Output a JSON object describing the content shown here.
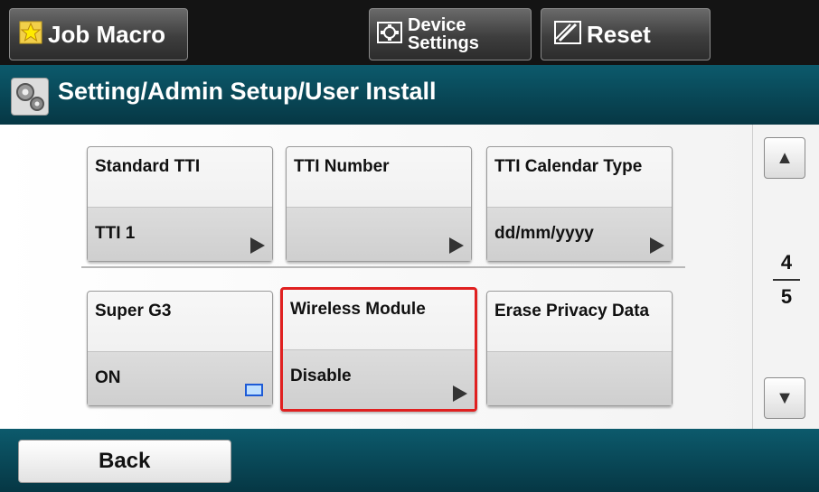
{
  "topbar": {
    "job_macro": "Job Macro",
    "device_settings_line1": "Device",
    "device_settings_line2": "Settings",
    "reset": "Reset"
  },
  "title": "Setting/Admin Setup/User Install",
  "tiles": [
    {
      "label": "Standard TTI",
      "value": "TTI 1",
      "indicator": "arrow"
    },
    {
      "label": "TTI Number",
      "value": "",
      "indicator": "arrow"
    },
    {
      "label": "TTI Calendar Type",
      "value": "dd/mm/yyyy",
      "indicator": "arrow"
    },
    {
      "label": "Super G3",
      "value": "ON",
      "indicator": "checkbox-icon"
    },
    {
      "label": "Wireless Module",
      "value": "Disable",
      "indicator": "arrow",
      "selected": true
    },
    {
      "label": "Erase Privacy Data",
      "value": "",
      "indicator": "none"
    }
  ],
  "pager": {
    "current": "4",
    "total": "5"
  },
  "bottom": {
    "back": "Back"
  },
  "colors": {
    "header_teal": "#0c5a6c",
    "selection_red": "#e02020",
    "topbar_bg": "#141414"
  }
}
